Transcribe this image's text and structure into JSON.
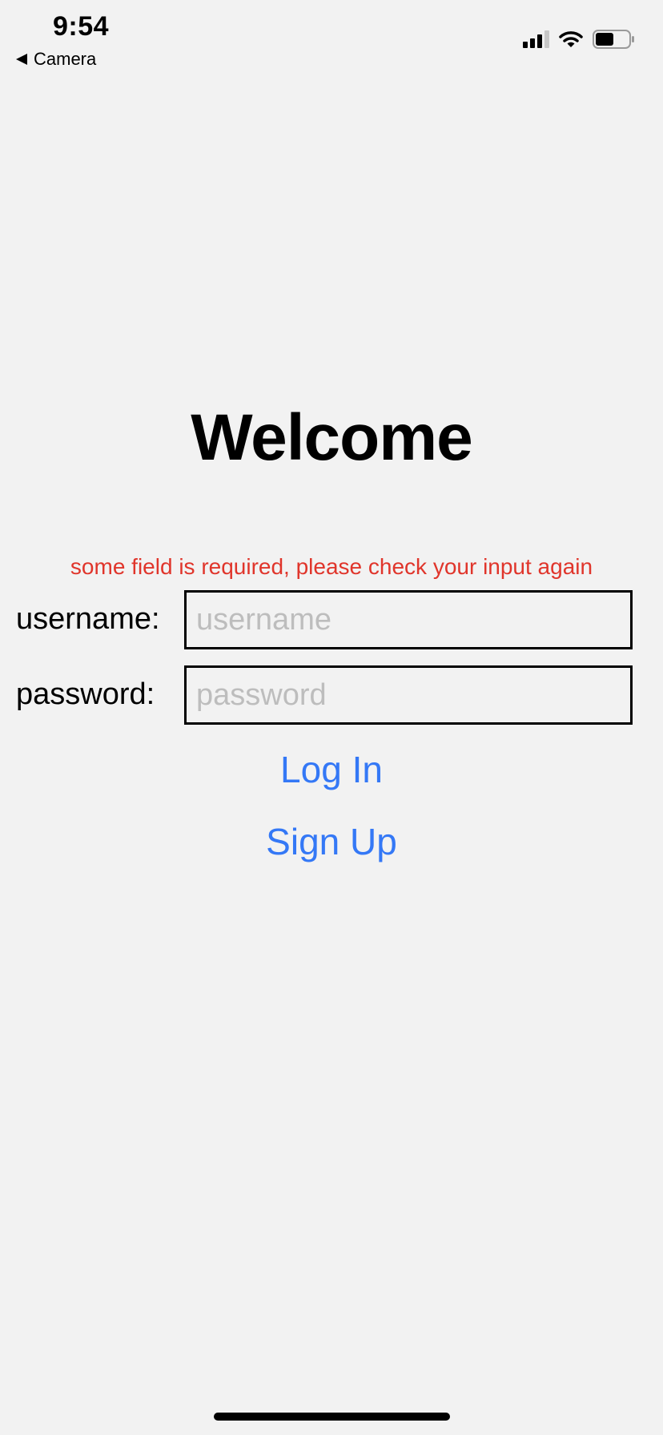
{
  "status_bar": {
    "time": "9:54",
    "back_label": "Camera",
    "icons": [
      "signal-icon",
      "wifi-icon",
      "battery-icon"
    ],
    "battery_level": 0.55
  },
  "screen": {
    "title": "Welcome",
    "error_message": "some field is required, please check your input again"
  },
  "form": {
    "username": {
      "label": "username:",
      "placeholder": "username",
      "value": ""
    },
    "password": {
      "label": "password:",
      "placeholder": "password",
      "value": ""
    }
  },
  "actions": {
    "login_label": "Log In",
    "signup_label": "Sign Up"
  },
  "colors": {
    "background": "#f2f2f2",
    "error": "#e0352b",
    "link": "#3478f6",
    "text": "#000000",
    "placeholder": "#bdbdbd"
  }
}
